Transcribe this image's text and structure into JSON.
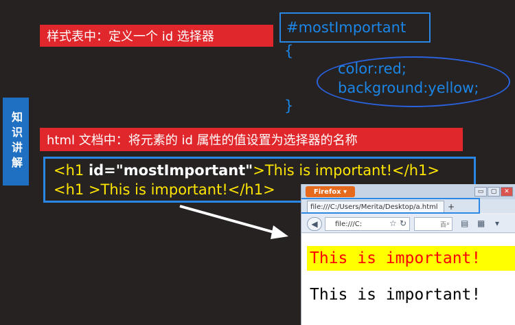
{
  "side_tab": {
    "text": "知识讲解"
  },
  "labels": {
    "stylesheet": "样式表中：定义一个 id 选择器",
    "html_doc": "html 文档中：将元素的 id 属性的值设置为选择器的名称"
  },
  "css_code": {
    "selector": "#mostImportant",
    "open_brace": "{",
    "prop1": "color:red;",
    "prop2": "background:yellow;",
    "close_brace": "}"
  },
  "html_code": {
    "line1_open": "<h1 ",
    "line1_attr": "id=\"mostImportant\"",
    "line1_rest": ">This  is important!</h1>",
    "line2": "<h1 >This is important!</h1>"
  },
  "firefox": {
    "menu_button": "Firefox ▾",
    "tab_title": "file:///C:/Users/Merita/Desktop/a.html",
    "new_tab": "+",
    "url": "file:///C:",
    "search_placeholder": "百 ",
    "min": "▭",
    "max": "▢",
    "close": "✕"
  },
  "page_content": {
    "h1_important": "This is important!",
    "h1_plain": "This is important!"
  },
  "colors": {
    "background": "#262222",
    "label_red": "#e0272b",
    "code_blue": "#1c86e6",
    "code_yellow": "#ffe600",
    "highlight_yellow": "#ffff00",
    "highlight_red": "#ff0000"
  }
}
